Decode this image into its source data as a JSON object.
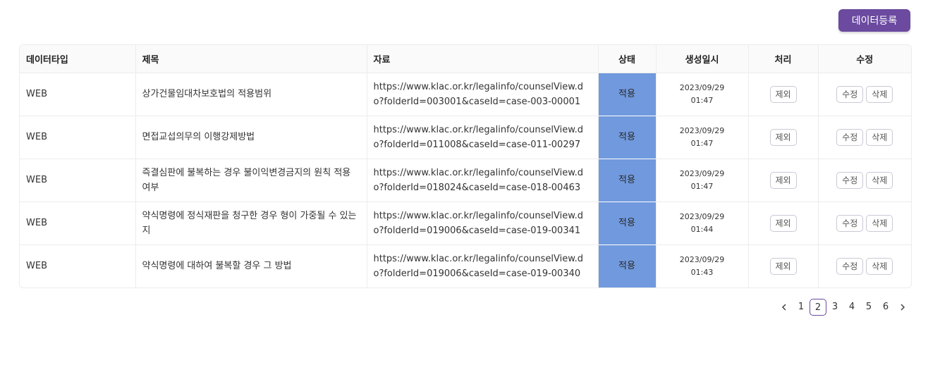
{
  "toolbar": {
    "register_label": "데이터등록"
  },
  "table": {
    "headers": [
      "데이터타입",
      "제목",
      "자료",
      "상태",
      "생성일시",
      "처리",
      "수정"
    ],
    "rows": [
      {
        "type": "WEB",
        "title": "상가건물임대차보호법의 적용범위",
        "url": "https://www.klac.or.kr/legalinfo/counselView.do?folderId=003001&caseId=case-003-00001",
        "status": "적용",
        "date": "2023/09/29",
        "time": "01:47",
        "exclude": "제외",
        "edit": "수정",
        "delete": "삭제"
      },
      {
        "type": "WEB",
        "title": "면접교섭의무의 이행강제방법",
        "url": "https://www.klac.or.kr/legalinfo/counselView.do?folderId=011008&caseId=case-011-00297",
        "status": "적용",
        "date": "2023/09/29",
        "time": "01:47",
        "exclude": "제외",
        "edit": "수정",
        "delete": "삭제"
      },
      {
        "type": "WEB",
        "title": "즉결심판에 불복하는 경우 불이익변경금지의 원칙 적용 여부",
        "url": "https://www.klac.or.kr/legalinfo/counselView.do?folderId=018024&caseId=case-018-00463",
        "status": "적용",
        "date": "2023/09/29",
        "time": "01:47",
        "exclude": "제외",
        "edit": "수정",
        "delete": "삭제"
      },
      {
        "type": "WEB",
        "title": "약식명령에 정식재판을 청구한 경우 형이 가중될 수 있는지",
        "url": "https://www.klac.or.kr/legalinfo/counselView.do?folderId=019006&caseId=case-019-00341",
        "status": "적용",
        "date": "2023/09/29",
        "time": "01:44",
        "exclude": "제외",
        "edit": "수정",
        "delete": "삭제"
      },
      {
        "type": "WEB",
        "title": "약식명령에 대하여 불복할 경우 그 방법",
        "url": "https://www.klac.or.kr/legalinfo/counselView.do?folderId=019006&caseId=case-019-00340",
        "status": "적용",
        "date": "2023/09/29",
        "time": "01:43",
        "exclude": "제외",
        "edit": "수정",
        "delete": "삭제"
      }
    ]
  },
  "pagination": {
    "prev_icon": "chevron-left-icon",
    "next_icon": "chevron-right-icon",
    "pages": [
      "1",
      "2",
      "3",
      "4",
      "5",
      "6"
    ],
    "current": "2"
  },
  "colors": {
    "accent": "#6b4aa0",
    "status_applied": "#7199dd"
  }
}
